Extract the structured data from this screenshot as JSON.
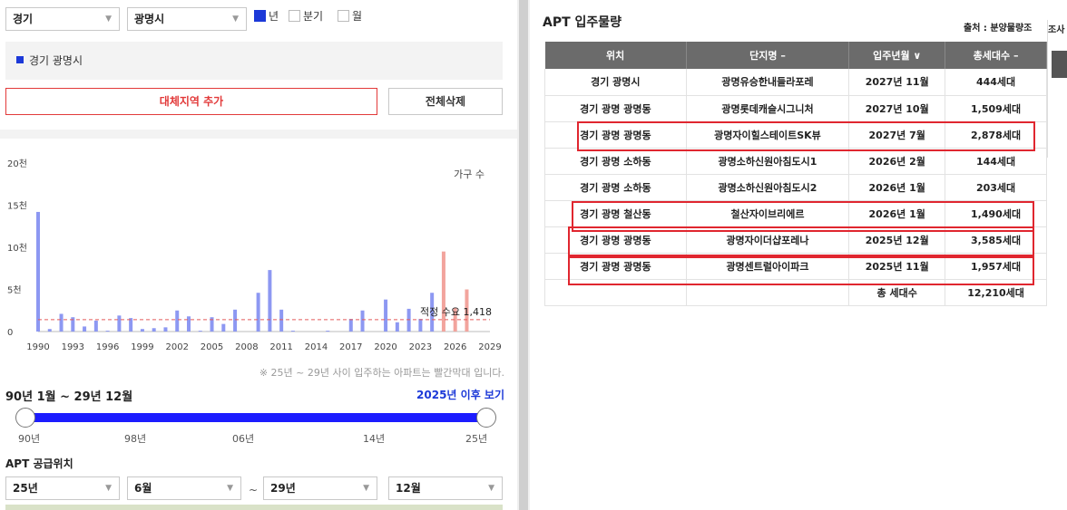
{
  "filters": {
    "province": "경기",
    "city": "광명시",
    "period_options": [
      {
        "label": "년",
        "checked": true
      },
      {
        "label": "분기",
        "checked": false
      },
      {
        "label": "월",
        "checked": false
      }
    ]
  },
  "region_tag": "경기 광명시",
  "buttons": {
    "add_region": "대체지역 추가",
    "delete_all": "전체삭제"
  },
  "chart_data": {
    "type": "bar",
    "legend_label": "가구 수",
    "y_ticks": [
      "20천",
      "15천",
      "10천",
      "5천",
      "0"
    ],
    "ylim": [
      0,
      20000
    ],
    "x_ticks": [
      "1990",
      "1993",
      "1996",
      "1999",
      "2002",
      "2005",
      "2008",
      "2011",
      "2014",
      "2017",
      "2020",
      "2023",
      "2026",
      "2029"
    ],
    "x": [
      1990,
      1991,
      1992,
      1993,
      1994,
      1995,
      1996,
      1997,
      1998,
      1999,
      2000,
      2001,
      2002,
      2003,
      2004,
      2005,
      2006,
      2007,
      2008,
      2009,
      2010,
      2011,
      2012,
      2013,
      2014,
      2015,
      2016,
      2017,
      2018,
      2019,
      2020,
      2021,
      2022,
      2023,
      2024,
      2025,
      2026,
      2027
    ],
    "values": [
      14200,
      300,
      2100,
      1700,
      600,
      1300,
      100,
      1900,
      1600,
      300,
      400,
      500,
      2500,
      1800,
      100,
      1700,
      900,
      2600,
      0,
      4600,
      7300,
      2600,
      100,
      0,
      0,
      100,
      0,
      1500,
      2500,
      0,
      3800,
      1100,
      2700,
      1500,
      4600,
      9500,
      2800,
      5000
    ],
    "highlight_from": 2025,
    "colors": {
      "normal": "#8d98f2",
      "future": "#f2a49d",
      "reference": "#e35b5b"
    },
    "reference": {
      "value": 1418,
      "label": "적정 수요 1,418"
    }
  },
  "chart_note": "※ 25년 ~ 29년 사이 입주하는 아파트는 빨간막대 입니다.",
  "period": {
    "title": "90년 1월 ~ 29년 12월",
    "after_link": "2025년 이후 보기",
    "slider_ticks": [
      "90년",
      "98년",
      "06년",
      "14년",
      "25년"
    ]
  },
  "supply": {
    "title": "APT 공급위치",
    "from_year": "25년",
    "from_month": "6월",
    "tilde": "~",
    "to_year": "29년",
    "to_month": "12월"
  },
  "apt": {
    "title": "APT 입주물량",
    "source": "출처 : 분양물량조",
    "columns": [
      "위치",
      "단지명 –",
      "입주년월 ∨",
      "총세대수 –"
    ],
    "rows": [
      [
        "경기 광명시",
        "광명유승한내들라포레",
        "2027년 11월",
        "444세대"
      ],
      [
        "경기 광명 광명동",
        "광명롯데캐슬시그니처",
        "2027년 10월",
        "1,509세대"
      ],
      [
        "경기 광명 광명동",
        "광명자이힐스테이트SK뷰",
        "2027년 7월",
        "2,878세대"
      ],
      [
        "경기 광명 소하동",
        "광명소하신원아침도시1",
        "2026년 2월",
        "144세대"
      ],
      [
        "경기 광명 소하동",
        "광명소하신원아침도시2",
        "2026년 1월",
        "203세대"
      ],
      [
        "경기 광명 철산동",
        "철산자이브리에르",
        "2026년 1월",
        "1,490세대"
      ],
      [
        "경기 광명 광명동",
        "광명자이더샵포레나",
        "2025년 12월",
        "3,585세대"
      ],
      [
        "경기 광명 광명동",
        "광명센트럴아이파크",
        "2025년 11월",
        "1,957세대"
      ]
    ],
    "total_label": "총 세대수",
    "total_value": "12,210세대"
  },
  "side_overlay_text": "조사"
}
